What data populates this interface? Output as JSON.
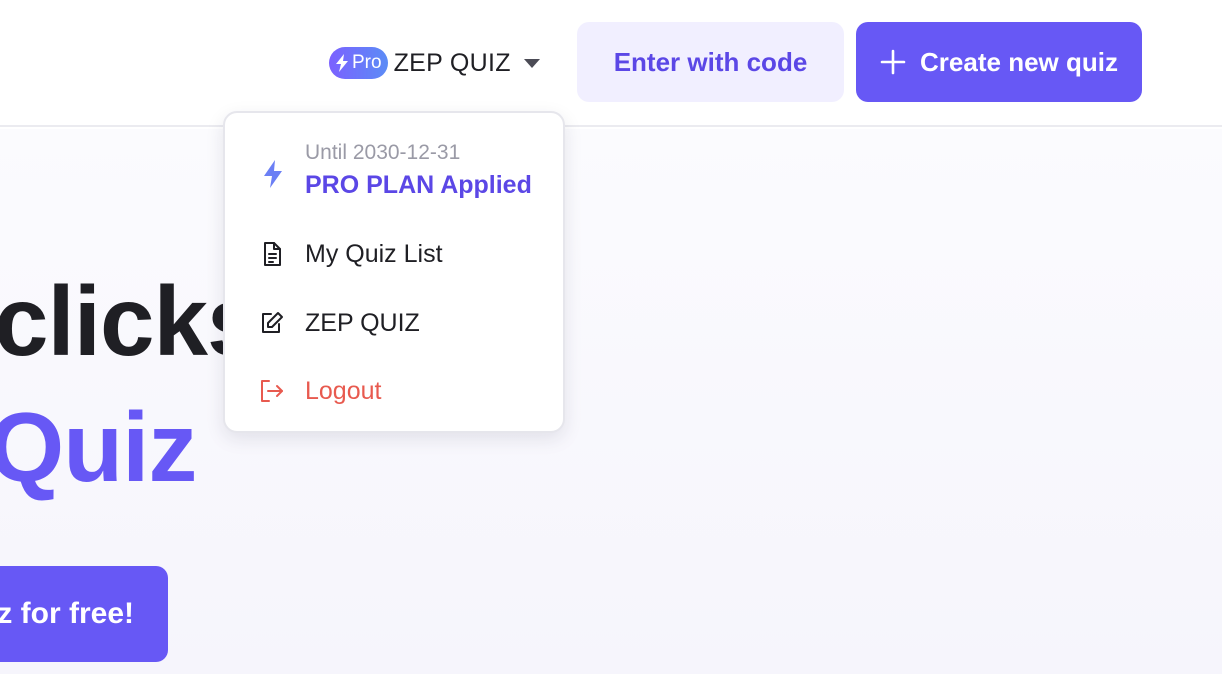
{
  "header": {
    "pro_badge": "Pro",
    "account_name": "ZEP QUIZ",
    "enter_code_label": "Enter with code",
    "create_quiz_label": "Create new quiz"
  },
  "hero": {
    "line1": "clicks",
    "line2": "Quiz",
    "cta_label": "z for free!"
  },
  "dropdown": {
    "plan": {
      "until": "Until 2030-12-31",
      "label": "PRO PLAN Applied",
      "icon": "bolt-icon"
    },
    "items": [
      {
        "label": "My Quiz List",
        "icon": "document-icon"
      },
      {
        "label": "ZEP QUIZ",
        "icon": "edit-icon"
      },
      {
        "label": "Logout",
        "icon": "logout-icon"
      }
    ]
  },
  "colors": {
    "primary": "#6758f5",
    "primary_text": "#5b47e6",
    "primary_light": "#f1efff",
    "danger": "#e85a4f",
    "muted": "#9a9aa6",
    "text": "#1f1f24"
  }
}
